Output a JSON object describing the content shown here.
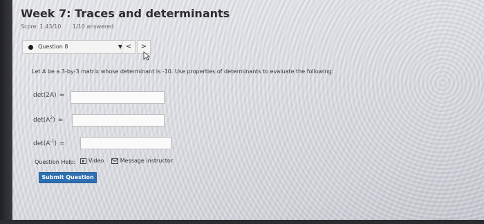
{
  "assignment": {
    "title": "Week 7: Traces and determinants",
    "score": "Score: 1.43/10",
    "answered": "1/10 answered"
  },
  "question_nav": {
    "selected": "Question 8",
    "prev_label": "<",
    "next_label": ">"
  },
  "question": {
    "prompt": "Let A be a 3-by-3 matrix whose determinant is -10. Use properties of determinants to evaluate the following:"
  },
  "parts": [
    {
      "label_prefix": "det(2A)",
      "sup": "",
      "label_suffix": "",
      "equals": "=",
      "value": ""
    },
    {
      "label_prefix": "det(A",
      "sup": "2",
      "label_suffix": ")",
      "equals": "=",
      "value": ""
    },
    {
      "label_prefix": "det(A",
      "sup": "-1",
      "label_suffix": ")",
      "equals": "=",
      "value": ""
    }
  ],
  "help": {
    "label": "Question Help:",
    "video": "Video",
    "message": "Message instructor"
  },
  "submit": {
    "label": "Submit Question"
  }
}
